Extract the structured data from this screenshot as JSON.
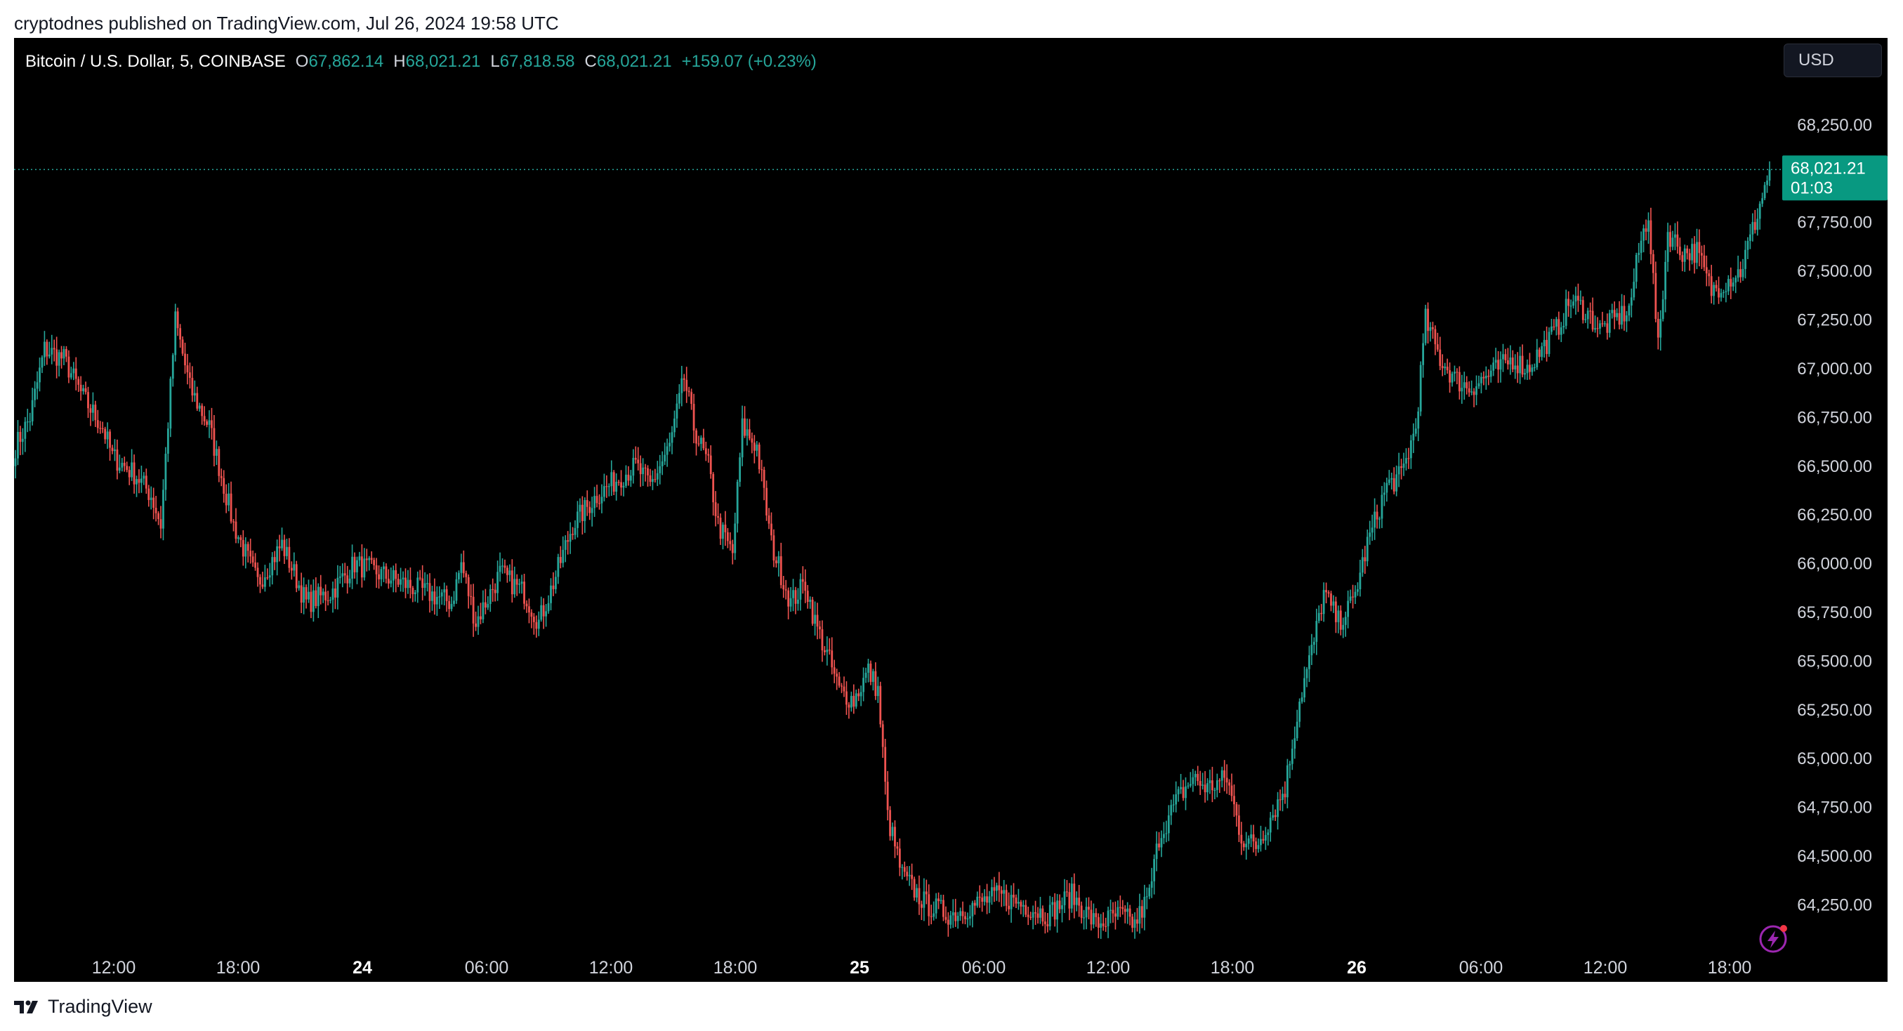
{
  "publisher_line": "cryptodnes published on TradingView.com, Jul 26, 2024 19:58 UTC",
  "legend": {
    "symbol": "Bitcoin / U.S. Dollar, 5, COINBASE",
    "o_key": "O",
    "o": "67,862.14",
    "h_key": "H",
    "h": "68,021.21",
    "l_key": "L",
    "l": "67,818.58",
    "c_key": "C",
    "c": "68,021.21",
    "change": "+159.07 (+0.23%)"
  },
  "currency": "USD",
  "last_price": {
    "price": "68,021.21",
    "countdown": "01:03"
  },
  "brand": "TradingView",
  "colors": {
    "up": "#26a69a",
    "down": "#ef5350",
    "background": "#000000",
    "text": "#d1d4dc"
  },
  "icons": {
    "brand_logo": "tradingview-logo-icon",
    "alert": "lightning-alert-icon"
  },
  "chart_data": {
    "type": "candlestick",
    "interval": "5",
    "yticks": [
      64250,
      64500,
      64750,
      65000,
      65250,
      65500,
      65750,
      66000,
      66250,
      66500,
      66750,
      67000,
      67250,
      67500,
      67750,
      68250
    ],
    "ytick_labels": [
      "64,250.00",
      "64,500.00",
      "64,750.00",
      "65,000.00",
      "65,250.00",
      "65,500.00",
      "65,750.00",
      "66,000.00",
      "66,250.00",
      "66,500.00",
      "66,750.00",
      "67,000.00",
      "67,250.00",
      "67,500.00",
      "67,750.00",
      "68,250.00"
    ],
    "xticks": [
      {
        "label": "12:00",
        "bold": false
      },
      {
        "label": "18:00",
        "bold": false
      },
      {
        "label": "24",
        "bold": true
      },
      {
        "label": "06:00",
        "bold": false
      },
      {
        "label": "12:00",
        "bold": false
      },
      {
        "label": "18:00",
        "bold": false
      },
      {
        "label": "25",
        "bold": true
      },
      {
        "label": "06:00",
        "bold": false
      },
      {
        "label": "12:00",
        "bold": false
      },
      {
        "label": "18:00",
        "bold": false
      },
      {
        "label": "26",
        "bold": true
      },
      {
        "label": "06:00",
        "bold": false
      },
      {
        "label": "12:00",
        "bold": false
      },
      {
        "label": "18:00",
        "bold": false
      }
    ],
    "ylim": [
      64050,
      68480
    ],
    "last_close": 68021.21,
    "path": [
      [
        0,
        66600
      ],
      [
        6,
        66750
      ],
      [
        12,
        67100
      ],
      [
        20,
        67050
      ],
      [
        28,
        66850
      ],
      [
        36,
        66700
      ],
      [
        40,
        66550
      ],
      [
        50,
        66450
      ],
      [
        56,
        66350
      ],
      [
        60,
        66200
      ],
      [
        66,
        67250
      ],
      [
        72,
        66900
      ],
      [
        80,
        66700
      ],
      [
        90,
        66200
      ],
      [
        100,
        65900
      ],
      [
        110,
        66100
      ],
      [
        120,
        65800
      ],
      [
        130,
        65850
      ],
      [
        140,
        66000
      ],
      [
        150,
        65950
      ],
      [
        160,
        65900
      ],
      [
        170,
        65850
      ],
      [
        180,
        65800
      ],
      [
        184,
        66000
      ],
      [
        190,
        65700
      ],
      [
        200,
        65950
      ],
      [
        210,
        65850
      ],
      [
        216,
        65700
      ],
      [
        222,
        65900
      ],
      [
        230,
        66200
      ],
      [
        240,
        66350
      ],
      [
        250,
        66450
      ],
      [
        256,
        66500
      ],
      [
        262,
        66400
      ],
      [
        270,
        66600
      ],
      [
        276,
        66950
      ],
      [
        280,
        66700
      ],
      [
        286,
        66500
      ],
      [
        290,
        66200
      ],
      [
        296,
        66050
      ],
      [
        300,
        66700
      ],
      [
        306,
        66600
      ],
      [
        312,
        66100
      ],
      [
        320,
        65800
      ],
      [
        326,
        65900
      ],
      [
        330,
        65700
      ],
      [
        336,
        65500
      ],
      [
        340,
        65350
      ],
      [
        346,
        65300
      ],
      [
        352,
        65450
      ],
      [
        356,
        65350
      ],
      [
        360,
        64700
      ],
      [
        366,
        64400
      ],
      [
        376,
        64250
      ],
      [
        386,
        64200
      ],
      [
        396,
        64250
      ],
      [
        406,
        64300
      ],
      [
        416,
        64250
      ],
      [
        426,
        64200
      ],
      [
        436,
        64300
      ],
      [
        446,
        64150
      ],
      [
        456,
        64200
      ],
      [
        462,
        64150
      ],
      [
        468,
        64300
      ],
      [
        472,
        64600
      ],
      [
        480,
        64800
      ],
      [
        486,
        64900
      ],
      [
        492,
        64850
      ],
      [
        500,
        64900
      ],
      [
        506,
        64600
      ],
      [
        512,
        64550
      ],
      [
        518,
        64700
      ],
      [
        524,
        64850
      ],
      [
        530,
        65300
      ],
      [
        536,
        65600
      ],
      [
        540,
        65850
      ],
      [
        546,
        65700
      ],
      [
        552,
        65800
      ],
      [
        558,
        66100
      ],
      [
        566,
        66400
      ],
      [
        572,
        66450
      ],
      [
        578,
        66700
      ],
      [
        582,
        67250
      ],
      [
        588,
        67050
      ],
      [
        594,
        66950
      ],
      [
        600,
        66900
      ],
      [
        606,
        66950
      ],
      [
        612,
        67000
      ],
      [
        618,
        67050
      ],
      [
        624,
        67000
      ],
      [
        630,
        67100
      ],
      [
        636,
        67200
      ],
      [
        642,
        67350
      ],
      [
        648,
        67300
      ],
      [
        654,
        67200
      ],
      [
        660,
        67250
      ],
      [
        666,
        67300
      ],
      [
        670,
        67600
      ],
      [
        674,
        67800
      ],
      [
        678,
        67100
      ],
      [
        682,
        67700
      ],
      [
        688,
        67600
      ],
      [
        694,
        67600
      ],
      [
        700,
        67400
      ],
      [
        706,
        67450
      ],
      [
        712,
        67500
      ],
      [
        718,
        67750
      ],
      [
        724,
        68021
      ]
    ]
  }
}
